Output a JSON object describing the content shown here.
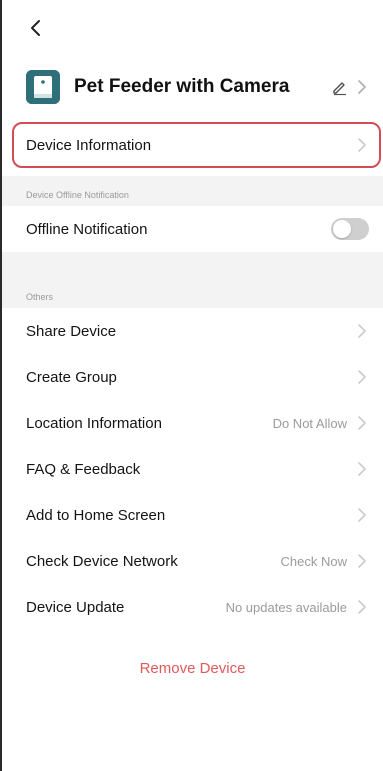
{
  "header": {
    "title": "Pet Feeder with Camera"
  },
  "rows": {
    "device_information": {
      "label": "Device Information"
    },
    "offline_section": {
      "title": "Device Offline Notification"
    },
    "offline_notification": {
      "label": "Offline Notification",
      "enabled": false
    },
    "others_section": {
      "title": "Others"
    },
    "share_device": {
      "label": "Share Device"
    },
    "create_group": {
      "label": "Create Group"
    },
    "location_information": {
      "label": "Location Information",
      "value": "Do Not Allow"
    },
    "faq_feedback": {
      "label": "FAQ & Feedback"
    },
    "add_home_screen": {
      "label": "Add to Home Screen"
    },
    "check_device_network": {
      "label": "Check Device Network",
      "value": "Check Now"
    },
    "device_update": {
      "label": "Device Update",
      "value": "No updates available"
    }
  },
  "actions": {
    "remove_device": "Remove Device"
  },
  "colors": {
    "highlight_border": "#d24b55",
    "remove_text": "#e15a5a",
    "device_icon": "#2f6f7a",
    "section_bg": "#f3f3f3"
  },
  "icons": {
    "back": "chevron-left-icon",
    "device": "pet-feeder-icon",
    "edit": "pencil-icon",
    "chevron": "chevron-right-icon"
  }
}
